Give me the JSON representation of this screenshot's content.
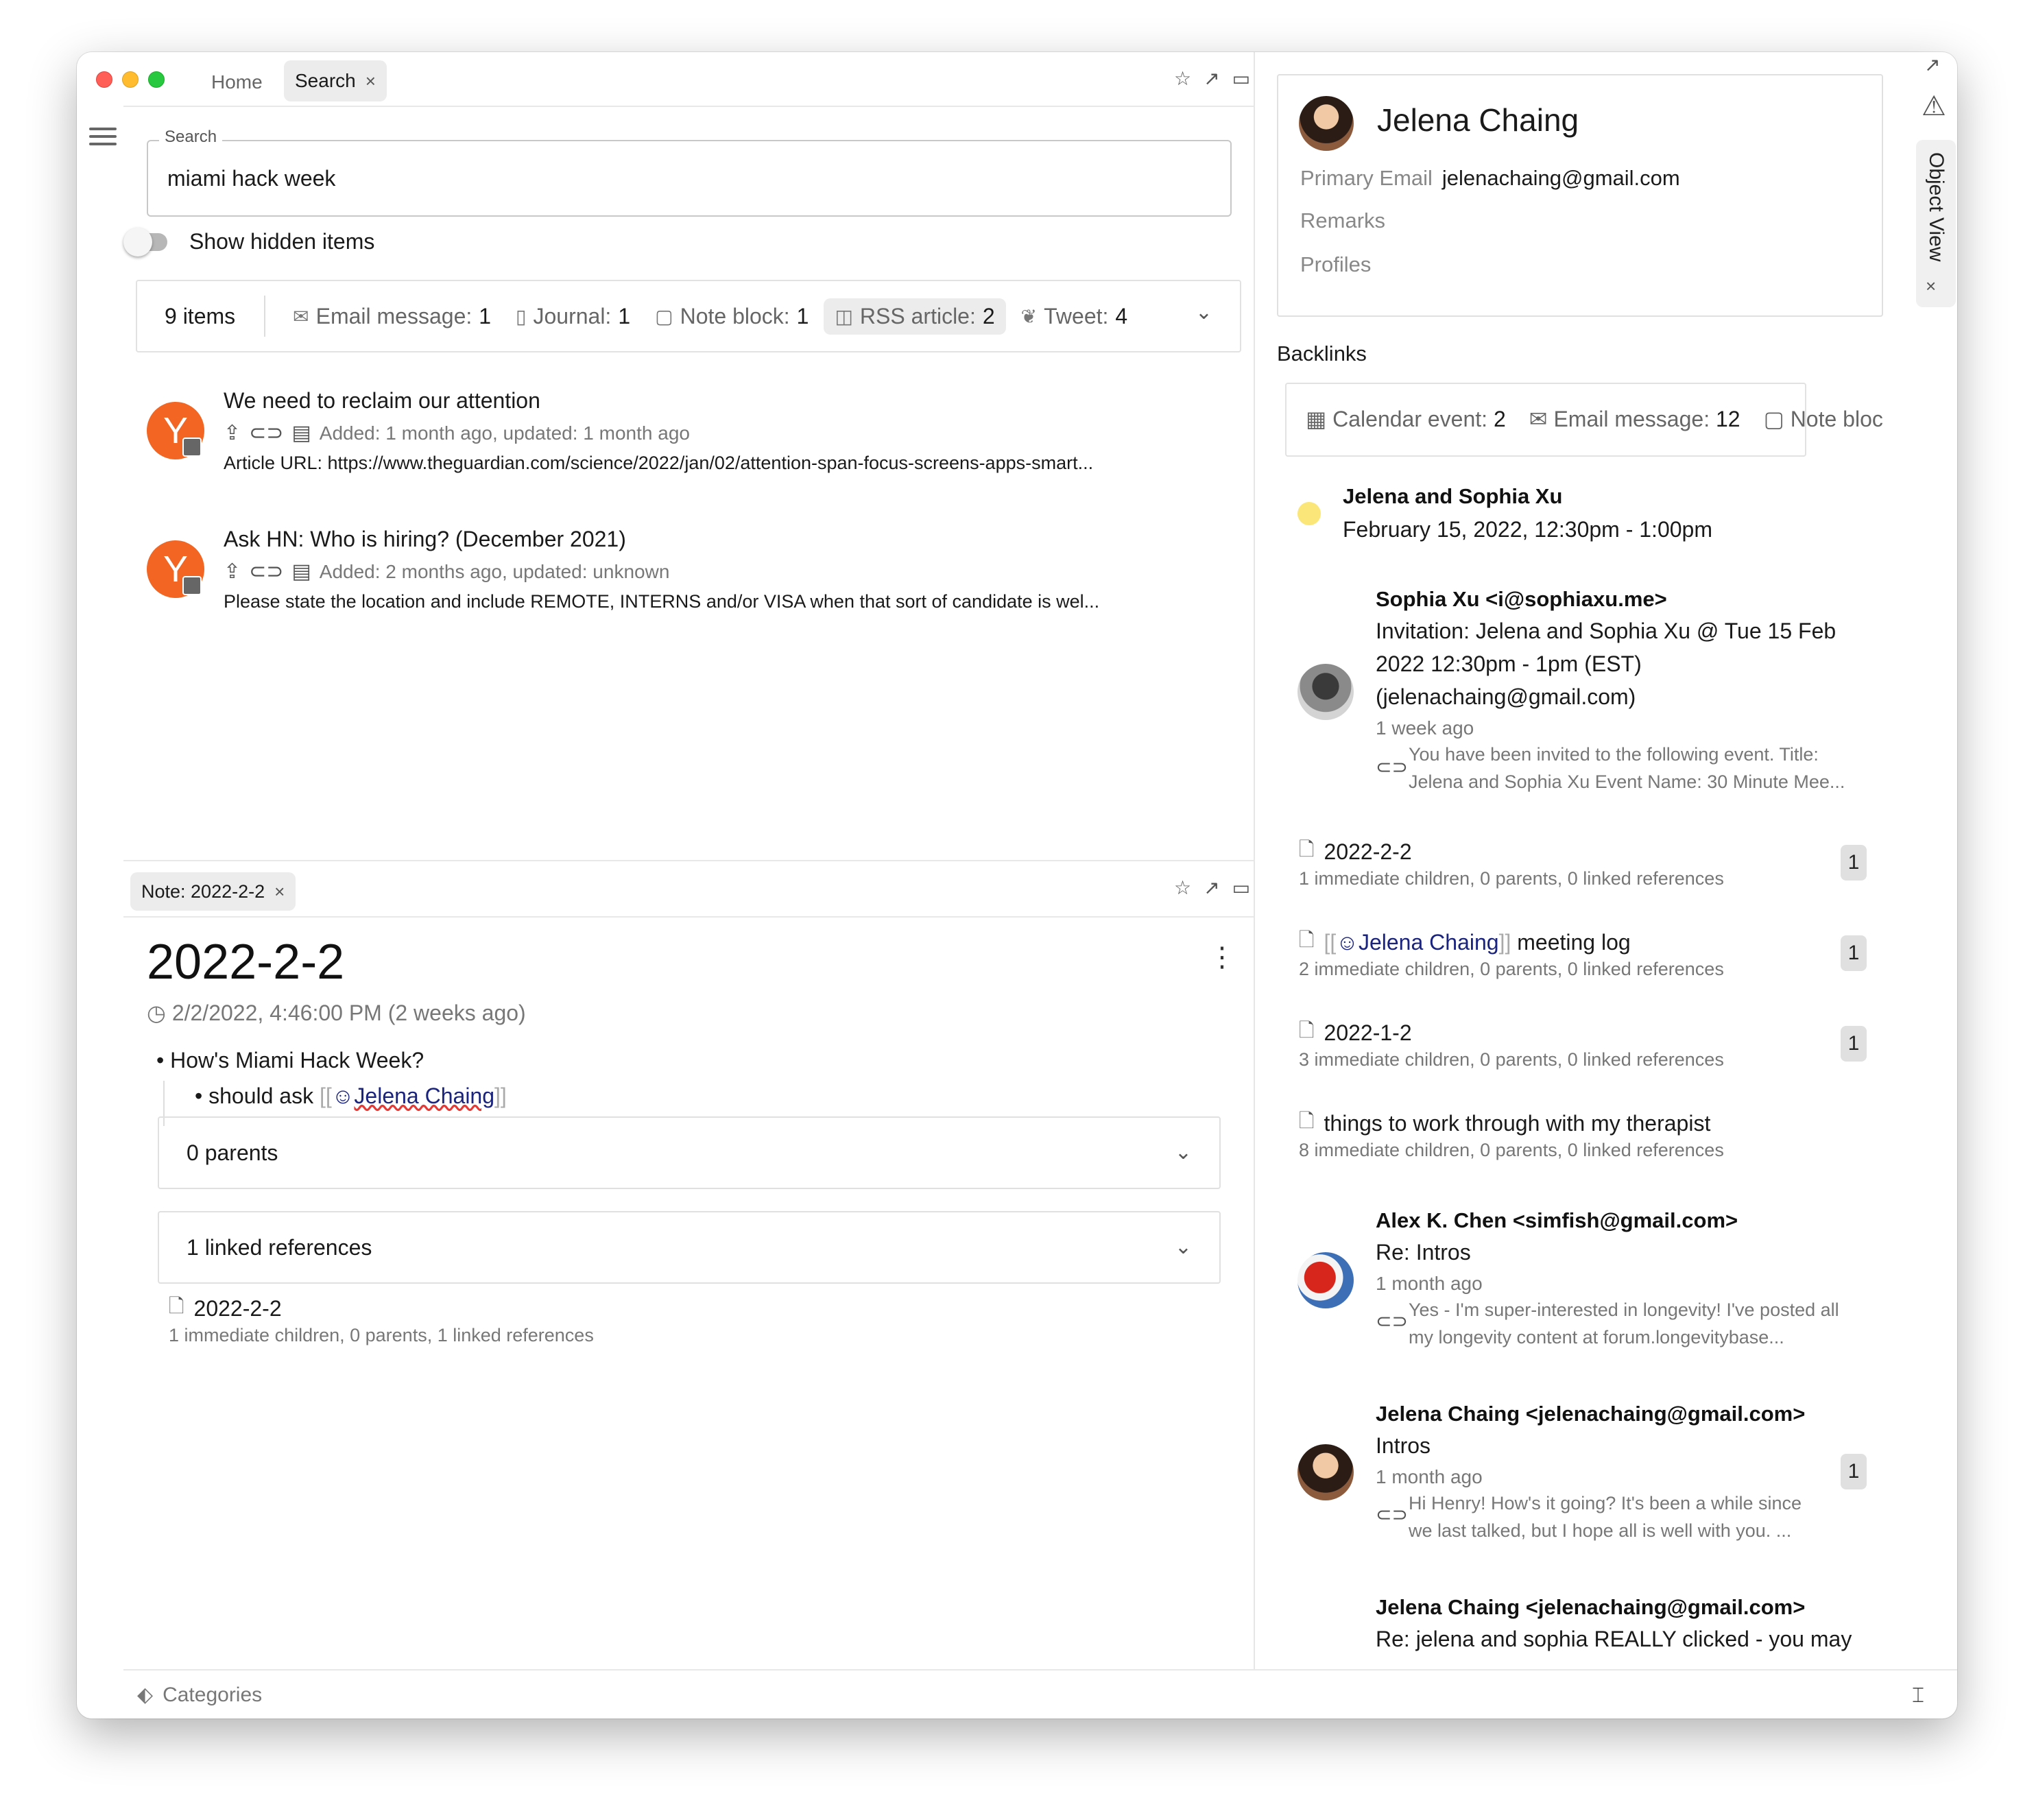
{
  "tabs": {
    "home": "Home",
    "search": "Search",
    "close": "×"
  },
  "search": {
    "label": "Search",
    "value": "miami hack week",
    "show_hidden_label": "Show hidden items"
  },
  "filters": {
    "count": "9 items",
    "chips": [
      {
        "label": "Email message:",
        "count": "1",
        "icon": "envelope-icon"
      },
      {
        "label": "Journal:",
        "count": "1",
        "icon": "journal-icon"
      },
      {
        "label": "Note block:",
        "count": "1",
        "icon": "note-icon"
      },
      {
        "label": "RSS article:",
        "count": "2",
        "icon": "rss-icon"
      },
      {
        "label": "Tweet:",
        "count": "4",
        "icon": "twitter-icon"
      }
    ]
  },
  "results": [
    {
      "avatar": "Y",
      "title": "We need to reclaim our attention",
      "meta": "Added: 1 month ago, updated: 1 month ago",
      "desc": "Article URL: https://www.theguardian.com/science/2022/jan/02/attention-span-focus-screens-apps-smart..."
    },
    {
      "avatar": "Y",
      "title": "Ask HN: Who is hiring? (December 2021)",
      "meta": "Added: 2 months ago, updated: unknown",
      "desc": "Please state the location and include REMOTE, INTERNS and/or VISA when that sort of candidate is wel..."
    }
  ],
  "note": {
    "tab_label": "Note: 2022-2-2",
    "title": "2022-2-2",
    "date": "2/2/2022, 4:46:00 PM (2 weeks ago)",
    "bullet1": "How's Miami Hack Week?",
    "bullet2_prefix": "should ask",
    "bullet2_link": "Jelena Chaing",
    "parents": "0 parents",
    "linked_refs": "1 linked references",
    "ref_title": "2022-2-2",
    "ref_sub": "1 immediate children, 0 parents, 1 linked references"
  },
  "footer": {
    "categories": "Categories"
  },
  "object": {
    "name": "Jelena Chaing",
    "email_label": "Primary Email",
    "email_value": "jelenachaing@gmail.com",
    "remarks": "Remarks",
    "profiles": "Profiles",
    "sidebar_tab": "Object View"
  },
  "backlinks": {
    "heading": "Backlinks",
    "chips": [
      {
        "label": "Calendar event:",
        "count": "2"
      },
      {
        "label": "Email message:",
        "count": "12"
      },
      {
        "label": "Note bloc",
        "count": ""
      }
    ],
    "event": {
      "title": "Jelena and Sophia Xu",
      "time": "February 15, 2022, 12:30pm - 1:00pm"
    },
    "email1": {
      "from": "Sophia Xu <i@sophiaxu.me>",
      "subject_l1": "Invitation: Jelena and Sophia Xu @ Tue 15 Feb",
      "subject_l2": "2022 12:30pm - 1pm (EST)",
      "subject_l3": "(jelenachaing@gmail.com)",
      "when": "1 week ago",
      "snip_l1": "You have been invited to the following event. Title:",
      "snip_l2": "Jelena and Sophia Xu Event Name: 30 Minute Mee..."
    },
    "notes": [
      {
        "title": "2022-2-2",
        "sub": "1 immediate children, 0 parents, 0 linked references",
        "badge": "1"
      },
      {
        "title_link": "Jelena Chaing",
        "title_suffix": "meeting log",
        "sub": "2 immediate children, 0 parents, 0 linked references",
        "badge": "1"
      },
      {
        "title": "2022-1-2",
        "sub": "3 immediate children, 0 parents, 0 linked references",
        "badge": "1"
      },
      {
        "title": "things to work through with my therapist",
        "sub": "8 immediate children, 0 parents, 0 linked references"
      }
    ],
    "email2": {
      "from": "Alex K. Chen <simfish@gmail.com>",
      "subject": "Re: Intros",
      "when": "1 month ago",
      "snip_l1": "Yes - I'm super-interested in longevity! I've posted all",
      "snip_l2": "my longevity content at forum.longevitybase..."
    },
    "email3": {
      "from": "Jelena Chaing <jelenachaing@gmail.com>",
      "subject": "Intros",
      "when": "1 month ago",
      "snip_l1": "Hi Henry! How's it going? It's been a while since",
      "snip_l2": "we last talked, but I hope all is well with you. ...",
      "badge": "1"
    },
    "email4": {
      "from": "Jelena Chaing <jelenachaing@gmail.com>",
      "subject": "Re: jelena and sophia REALLY clicked - you may"
    }
  }
}
